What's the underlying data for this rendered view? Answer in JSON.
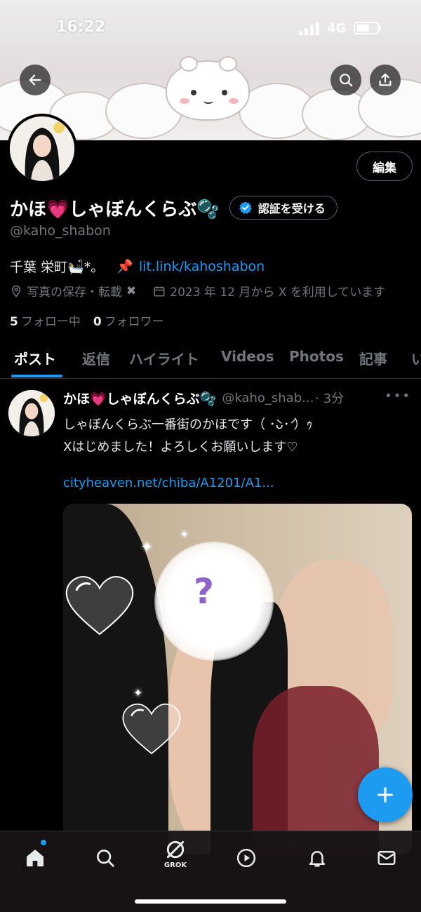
{
  "status_bar": {
    "time": "16:22",
    "network": "4G"
  },
  "profile": {
    "display_name": "かほ💗しゃぼんくらぶ🫧",
    "handle": "@kaho_shabon",
    "edit_label": "編集",
    "verify_label": "認証を受ける",
    "bio_text": "千葉 栄町🛀*。",
    "bio_pin": "📌",
    "bio_link": "lit.link/kahoshabon",
    "meta_saving": "写真の保存・転載",
    "meta_joined": "2023 年 12 月から X を利用しています",
    "following_count": "5",
    "following_label": "フォロー中",
    "followers_count": "0",
    "followers_label": "フォロワー"
  },
  "tabs": [
    "ポスト",
    "返信",
    "ハイライト",
    "Videos",
    "Photos",
    "記事",
    "い"
  ],
  "post": {
    "name": "かほ💗しゃぼんくらぶ🫧",
    "handle": "@kaho_shab...",
    "time": "· 3分",
    "text_line1": "しゃぼんくらぶ一番街のかほです（ ･̀ᴗ･́ ）ｩ",
    "text_line2": "Xはじめました！よろしくお願いします♡",
    "link": "cityheaven.net/chiba/A1201/A1...",
    "media_overlay": "?"
  },
  "bottom_nav": {
    "grok_label": "GROK"
  },
  "colors": {
    "accent": "#1d9bf0",
    "background": "#000000",
    "muted": "#71767b"
  },
  "icons": [
    "back-arrow-icon",
    "search-icon",
    "share-icon",
    "verified-badge-icon",
    "location-icon",
    "calendar-icon",
    "more-icon",
    "compose-icon",
    "home-icon",
    "explore-icon",
    "grok-icon",
    "play-icon",
    "bell-icon",
    "mail-icon"
  ]
}
